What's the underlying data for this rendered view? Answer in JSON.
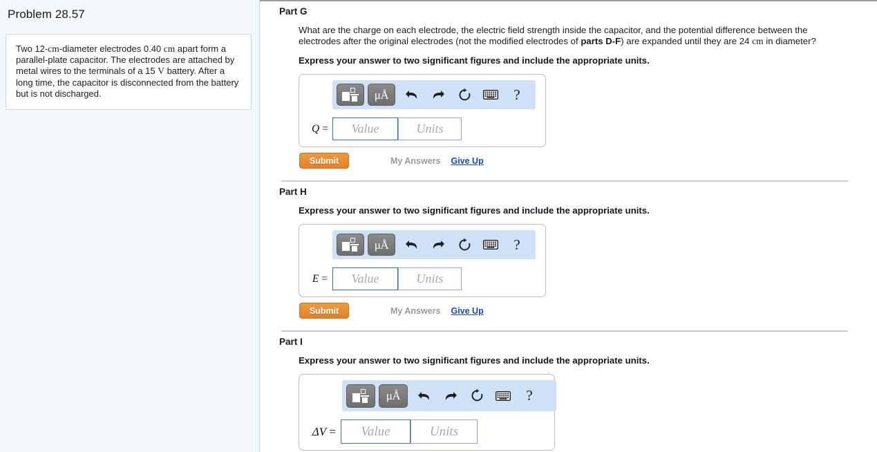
{
  "sidebar": {
    "problem_title": "Problem 28.57",
    "problem_statement_segments": [
      {
        "t": "Two 12-",
        "m": false
      },
      {
        "t": "cm",
        "m": true
      },
      {
        "t": "-diameter electrodes 0.40 ",
        "m": false
      },
      {
        "t": "cm",
        "m": true
      },
      {
        "t": " apart form a parallel-plate capacitor. The electrodes are attached by metal wires to the terminals of a 15 ",
        "m": false
      },
      {
        "t": "V",
        "m": true
      },
      {
        "t": " battery. After a long time, the capacitor is disconnected from the battery but is not discharged.",
        "m": false
      }
    ]
  },
  "toolbar": {
    "template_button_label": "template-matrix",
    "units_button_label": "μÅ",
    "undo_label": "undo",
    "redo_label": "redo",
    "reset_label": "reset",
    "keyboard_label": "keyboard",
    "help_label": "?"
  },
  "actions": {
    "submit_label": "Submit",
    "my_answers_label": "My Answers",
    "give_up_label": "Give Up"
  },
  "fields": {
    "value_placeholder": "Value",
    "units_placeholder": "Units"
  },
  "colors": {
    "accent_orange": "#e2822a",
    "link_blue": "#1a46b8",
    "toolbar_blue": "#cfe1f7",
    "sidebar_bg": "#f4f7fc",
    "field_border_focus": "#4169b4",
    "field_border_idle": "#8fa8cd"
  },
  "parts": [
    {
      "header": "Part G",
      "question_segments": [
        {
          "t": "What are the charge on each electrode, the electric field strength inside the capacitor, and the potential difference between the electrodes after the original electrodes (not the modified electrodes of ",
          "b": false,
          "m": false
        },
        {
          "t": "parts D-F",
          "b": true,
          "m": false
        },
        {
          "t": ") are expanded until they are 24 ",
          "b": false,
          "m": false
        },
        {
          "t": "cm",
          "b": false,
          "m": true
        },
        {
          "t": " in diameter?",
          "b": false,
          "m": false
        }
      ],
      "instruction": "Express your answer to two significant figures and include the appropriate units.",
      "variable": "Q",
      "equals": "=",
      "has_submit": true
    },
    {
      "header": "Part H",
      "question_segments": [],
      "instruction": "Express your answer to two significant figures and include the appropriate units.",
      "variable": "E",
      "equals": "=",
      "has_submit": true
    },
    {
      "header": "Part I",
      "question_segments": [],
      "instruction": "Express your answer to two significant figures and include the appropriate units.",
      "variable": "ΔV",
      "equals": "=",
      "has_submit": false
    }
  ]
}
